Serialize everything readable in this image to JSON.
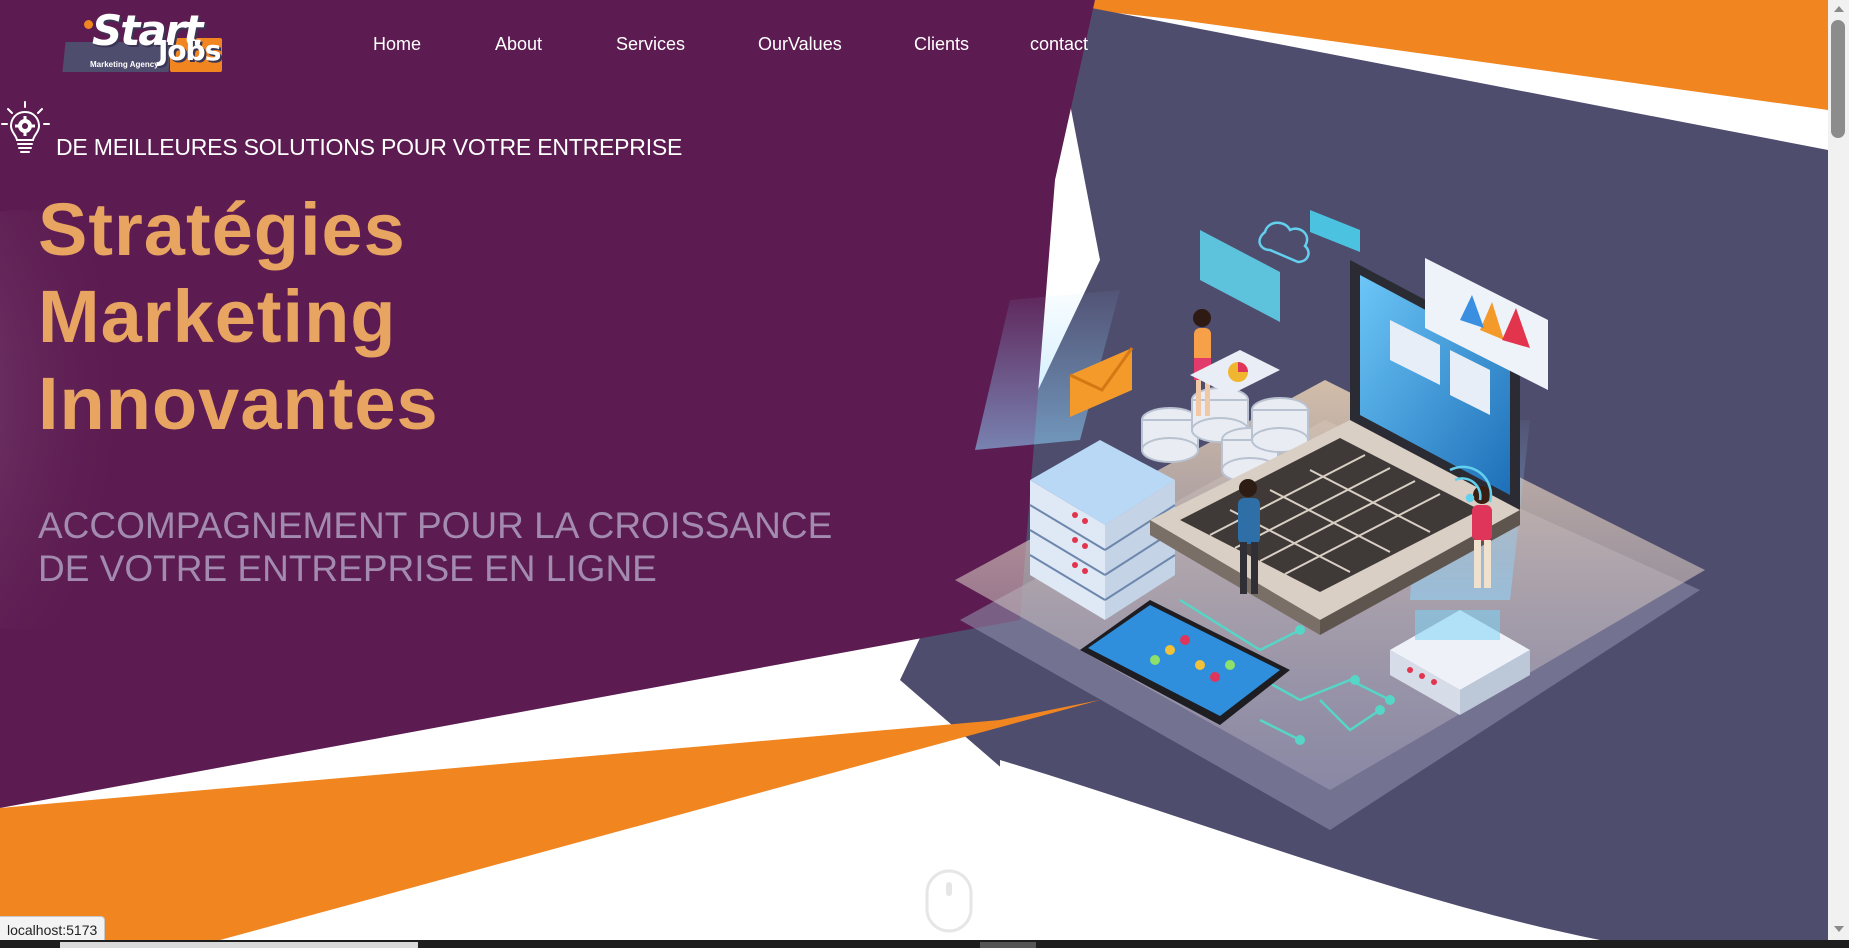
{
  "logo": {
    "word_start": "Start",
    "word_jobs": "Jobs",
    "subtitle": "Marketing Agency"
  },
  "nav": {
    "items": [
      {
        "label": "Home"
      },
      {
        "label": "About"
      },
      {
        "label": "Services"
      },
      {
        "label": "OurValues"
      },
      {
        "label": "Clients"
      },
      {
        "label": "contact"
      }
    ]
  },
  "hero": {
    "tagline": "DE MEILLEURES SOLUTIONS POUR VOTRE ENTREPRISE",
    "headline": [
      "Stratégies",
      "Marketing",
      "Innovantes"
    ],
    "subheadline": [
      "ACCOMPAGNEMENT POUR LA CROISSANCE",
      "DE VOTRE ENTREPRISE EN LIGNE"
    ]
  },
  "status_bar": {
    "url": "localhost:5173"
  },
  "colors": {
    "purple": "#5c1c51",
    "orange": "#f18520",
    "slate": "#4f4d6e",
    "headline": "#e8a461",
    "subheadline": "#a38bb0"
  },
  "icons": [
    "lightbulb-gear-icon",
    "scroll-mouse-icon"
  ]
}
